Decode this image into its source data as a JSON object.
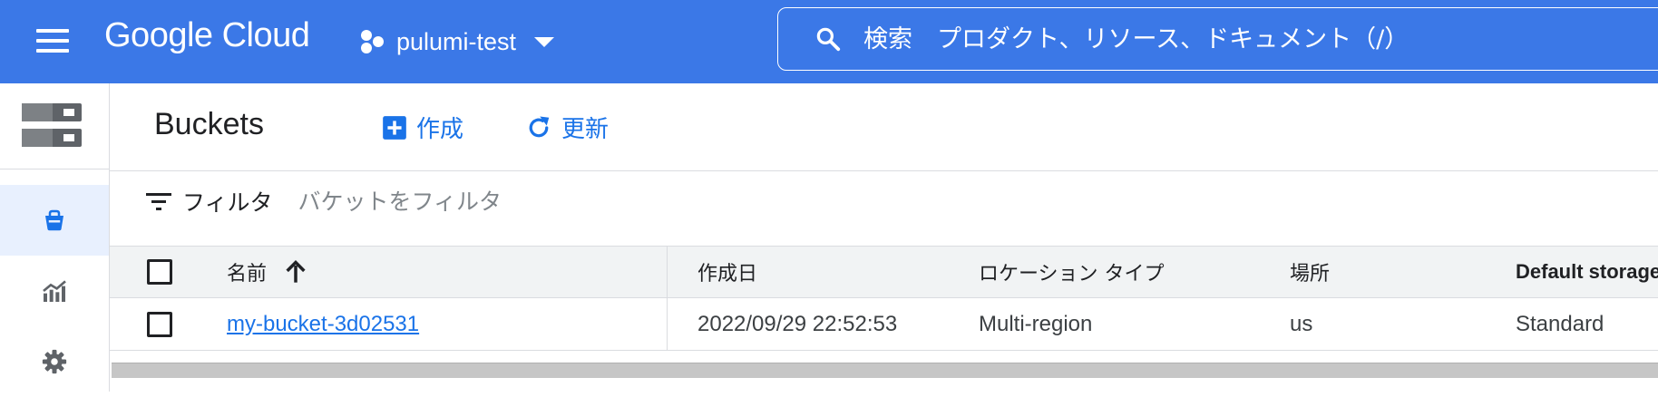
{
  "header": {
    "logo_text": "Google Cloud",
    "project_name": "pulumi-test",
    "search_placeholder": "検索　プロダクト、リソース、ドキュメント（/）"
  },
  "colors": {
    "topbar": "#3b78e7",
    "accent": "#1a73e8",
    "rail_active": "#e8f0fe"
  },
  "rail": {
    "items": [
      {
        "icon": "bucket-icon",
        "active": true
      },
      {
        "icon": "monitoring-icon",
        "active": false
      },
      {
        "icon": "settings-icon",
        "active": false
      }
    ]
  },
  "page": {
    "title": "Buckets",
    "create_label": "作成",
    "refresh_label": "更新"
  },
  "filter": {
    "label": "フィルタ",
    "placeholder": "バケットをフィルタ"
  },
  "table": {
    "columns": [
      "名前",
      "作成日",
      "ロケーション タイプ",
      "場所",
      "Default storage"
    ],
    "sort_column": "名前",
    "sort_direction": "ascending",
    "rows": [
      {
        "name": "my-bucket-3d02531",
        "created": "2022/09/29 22:52:53",
        "location_type": "Multi-region",
        "location": "us",
        "storage_class": "Standard"
      }
    ]
  }
}
